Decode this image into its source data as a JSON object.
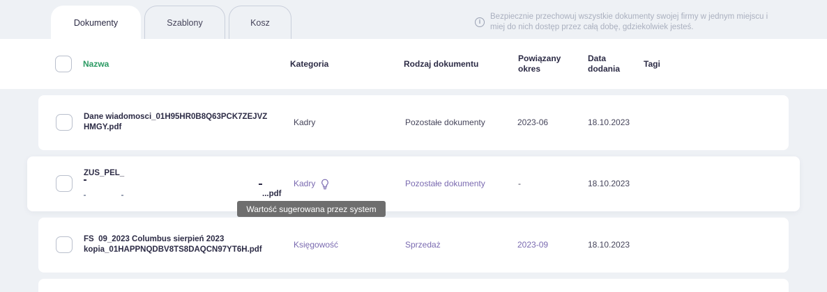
{
  "tabs": [
    {
      "label": "Dokumenty",
      "active": true
    },
    {
      "label": "Szablony",
      "active": false
    },
    {
      "label": "Kosz",
      "active": false
    }
  ],
  "info_text": "Bezpiecznie przechowuj wszystkie dokumenty swojej firmy w jednym miejscu i miej do nich dostęp przez całą dobę, gdziekolwiek jesteś.",
  "columns": {
    "name": "Nazwa",
    "category": "Kategoria",
    "doc_type": "Rodzaj dokumentu",
    "period_line1": "Powiązany",
    "period_line2": "okres",
    "date_line1": "Data",
    "date_line2": "dodania",
    "tags": "Tagi"
  },
  "rows": [
    {
      "name_line1": "Dane wiadomosci_01H95HR0B8Q63PCK7ZEJVZ",
      "name_line2": "HMGY.pdf",
      "category": "Kadry",
      "doc_type": "Pozostałe dokumenty",
      "period": "2023-06",
      "date": "18.10.2023"
    },
    {
      "name_line1": "ZUS_PEL_",
      "name_line3": ".pdf",
      "category": "Kadry",
      "doc_type": "Pozostałe dokumenty",
      "period": "-",
      "date": "18.10.2023"
    },
    {
      "name_line1": "FS  09_2023 Columbus sierpień 2023",
      "name_line2": "kopia_01HAPPNQDBV8TS8DAQCN97YT6H.pdf",
      "category": "Księgowość",
      "doc_type": "Sprzedaż",
      "period": "2023-09",
      "date": "18.10.2023"
    }
  ],
  "tooltip": "Wartość sugerowana przez system",
  "colors": {
    "page_bg": "#eef1f5",
    "name_header": "#2b9a63",
    "suggested_value": "#7a6ab0"
  }
}
